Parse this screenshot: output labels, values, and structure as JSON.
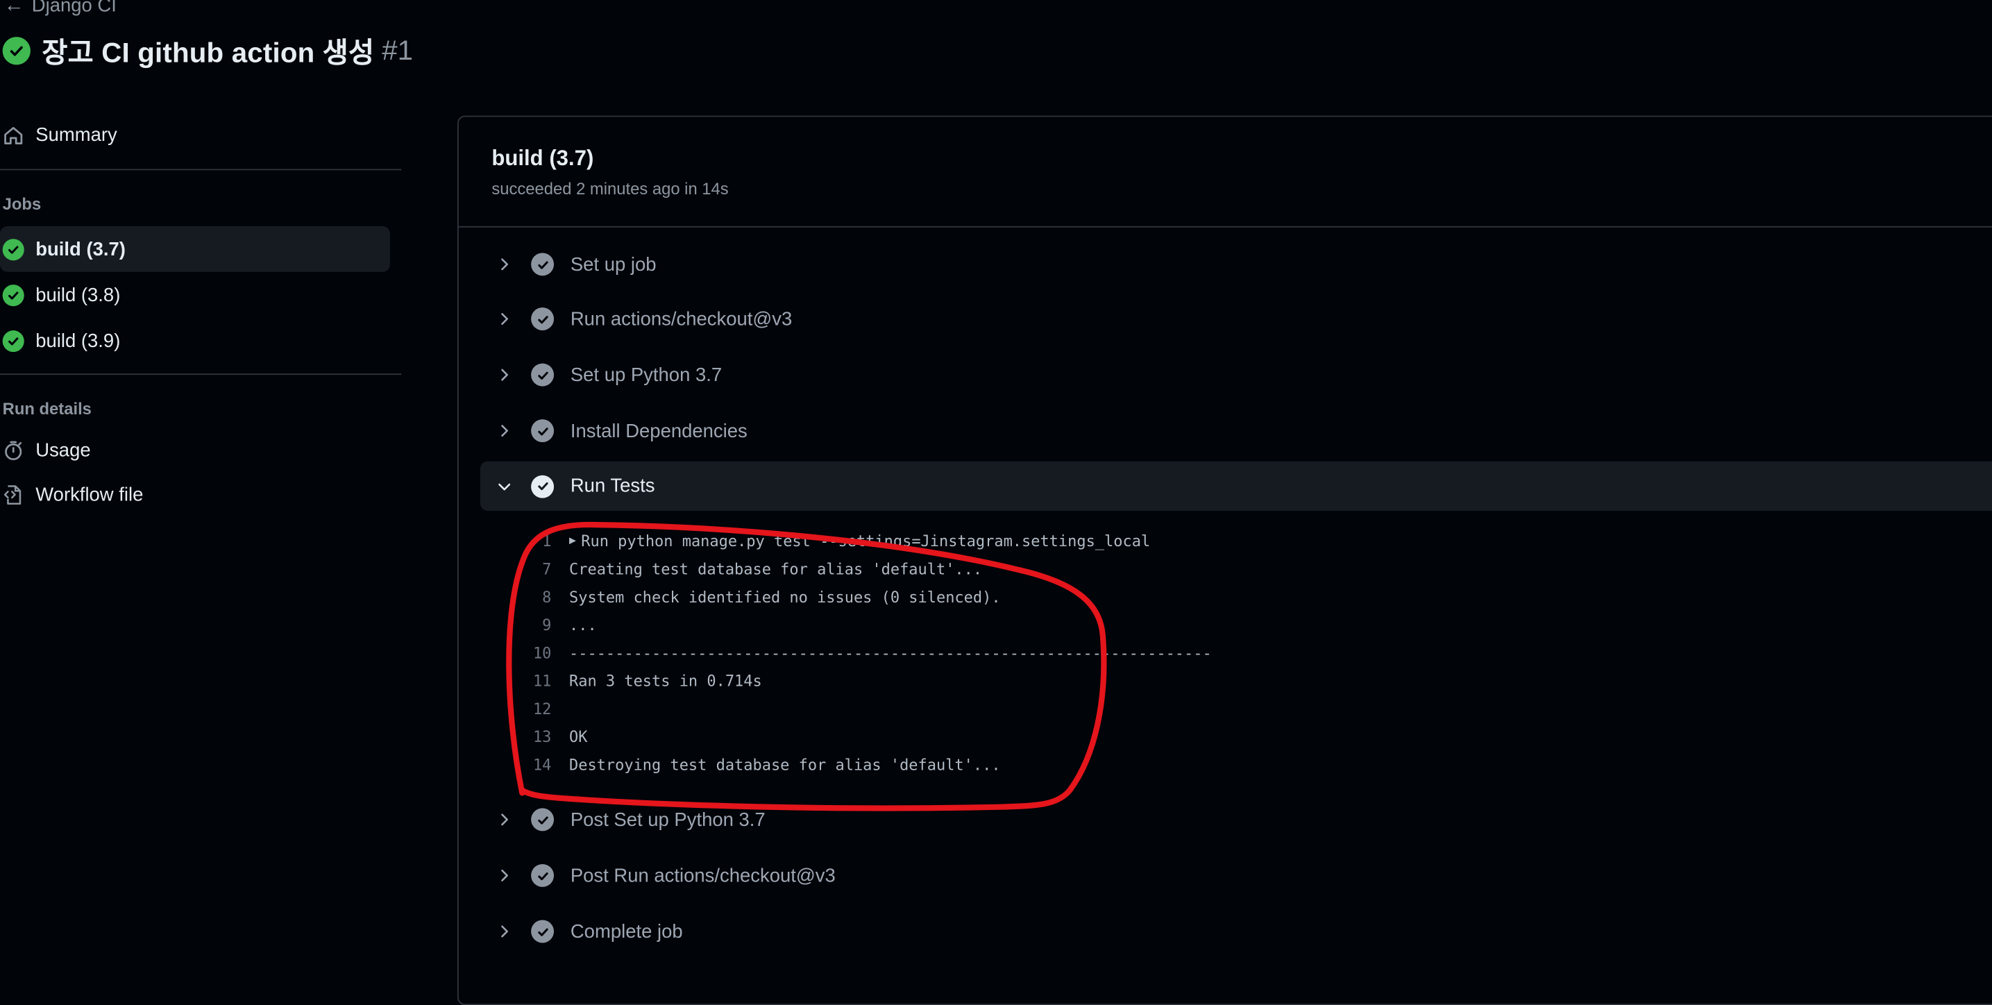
{
  "header": {
    "back_label": "Django CI",
    "run_title": "장고 CI github action 생성",
    "run_number": "#1"
  },
  "sidebar": {
    "summary_label": "Summary",
    "jobs_heading": "Jobs",
    "jobs": [
      {
        "label": "build (3.7)",
        "active": true
      },
      {
        "label": "build (3.8)",
        "active": false
      },
      {
        "label": "build (3.9)",
        "active": false
      }
    ],
    "run_details_heading": "Run details",
    "usage_label": "Usage",
    "workflow_file_label": "Workflow file"
  },
  "job": {
    "title": "build (3.7)",
    "meta": "succeeded 2 minutes ago in 14s",
    "steps": [
      {
        "label": "Set up job",
        "expanded": false
      },
      {
        "label": "Run actions/checkout@v3",
        "expanded": false
      },
      {
        "label": "Set up Python 3.7",
        "expanded": false
      },
      {
        "label": "Install Dependencies",
        "expanded": false
      },
      {
        "label": "Run Tests",
        "expanded": true
      },
      {
        "label": "Post Set up Python 3.7",
        "expanded": false
      },
      {
        "label": "Post Run actions/checkout@v3",
        "expanded": false
      },
      {
        "label": "Complete job",
        "expanded": false
      }
    ],
    "log": [
      {
        "num": "1",
        "text": "Run python manage.py test --settings=Jinstagram.settings_local",
        "collapsible": true
      },
      {
        "num": "7",
        "text": "Creating test database for alias 'default'..."
      },
      {
        "num": "8",
        "text": "System check identified no issues (0 silenced)."
      },
      {
        "num": "9",
        "text": "..."
      },
      {
        "num": "10",
        "text": "----------------------------------------------------------------------"
      },
      {
        "num": "11",
        "text": "Ran 3 tests in 0.714s"
      },
      {
        "num": "12",
        "text": ""
      },
      {
        "num": "13",
        "text": "OK"
      },
      {
        "num": "14",
        "text": "Destroying test database for alias 'default'..."
      }
    ]
  },
  "colors": {
    "success": "#3fb950",
    "annotation": "#e5151c",
    "background": "#010409"
  }
}
